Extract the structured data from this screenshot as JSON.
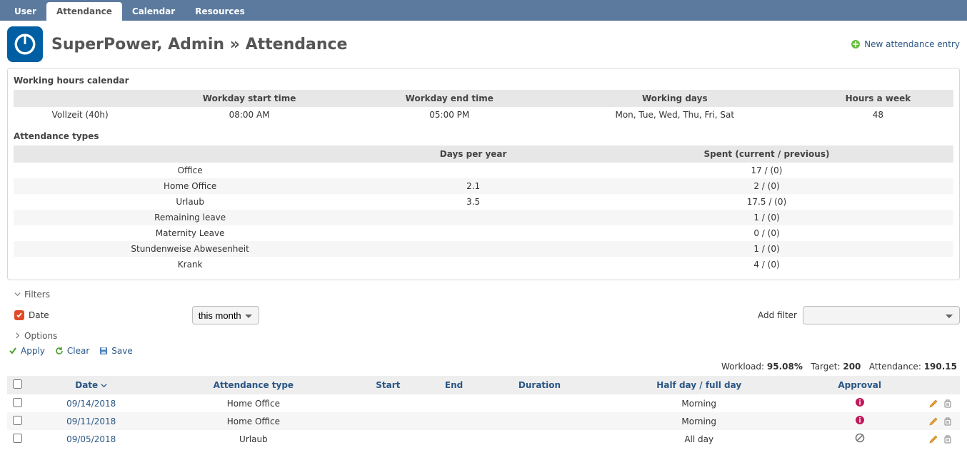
{
  "tabs": [
    {
      "label": "User",
      "active": false
    },
    {
      "label": "Attendance",
      "active": true
    },
    {
      "label": "Calendar",
      "active": false
    },
    {
      "label": "Resources",
      "active": false
    }
  ],
  "header": {
    "user_name": "SuperPower, Admin",
    "separator": "»",
    "section": "Attendance",
    "new_entry_label": "New attendance entry"
  },
  "working_hours": {
    "title": "Working hours calendar",
    "columns": [
      "",
      "Workday start time",
      "Workday end time",
      "Working days",
      "Hours a week"
    ],
    "row": {
      "name": "Vollzeit (40h)",
      "start": "08:00 AM",
      "end": "05:00 PM",
      "days": "Mon, Tue, Wed, Thu, Fri, Sat",
      "hours": "48"
    }
  },
  "attendance_types": {
    "title": "Attendance types",
    "columns": [
      "",
      "Days per year",
      "Spent (current / previous)"
    ],
    "rows": [
      {
        "name": "Office",
        "dpy": "",
        "spent": "17 / (0)"
      },
      {
        "name": "Home Office",
        "dpy": "2.1",
        "spent": "2 / (0)"
      },
      {
        "name": "Urlaub",
        "dpy": "3.5",
        "spent": "17.5 / (0)"
      },
      {
        "name": "Remaining leave",
        "dpy": "",
        "spent": "1 / (0)"
      },
      {
        "name": "Maternity Leave",
        "dpy": "",
        "spent": "0 / (0)"
      },
      {
        "name": "Stundenweise Abwesenheit",
        "dpy": "",
        "spent": "1 / (0)"
      },
      {
        "name": "Krank",
        "dpy": "",
        "spent": "4 / (0)"
      }
    ]
  },
  "filters": {
    "section_label": "Filters",
    "date_label": "Date",
    "date_value": "this month",
    "add_filter_label": "Add filter"
  },
  "options": {
    "section_label": "Options"
  },
  "actions": {
    "apply": "Apply",
    "clear": "Clear",
    "save": "Save"
  },
  "stats": {
    "workload_label": "Workload:",
    "workload_value": "95.08%",
    "target_label": "Target:",
    "target_value": "200",
    "attendance_label": "Attendance:",
    "attendance_value": "190.15"
  },
  "entries": {
    "columns": {
      "date": "Date",
      "type": "Attendance type",
      "start": "Start",
      "end": "End",
      "duration": "Duration",
      "halfday": "Half day / full day",
      "approval": "Approval"
    },
    "rows": [
      {
        "date": "09/14/2018",
        "type": "Home Office",
        "start": "",
        "end": "",
        "duration": "",
        "halfday": "Morning",
        "approval": "info"
      },
      {
        "date": "09/11/2018",
        "type": "Home Office",
        "start": "",
        "end": "",
        "duration": "",
        "halfday": "Morning",
        "approval": "info"
      },
      {
        "date": "09/05/2018",
        "type": "Urlaub",
        "start": "",
        "end": "",
        "duration": "",
        "halfday": "All day",
        "approval": "deny"
      }
    ]
  }
}
